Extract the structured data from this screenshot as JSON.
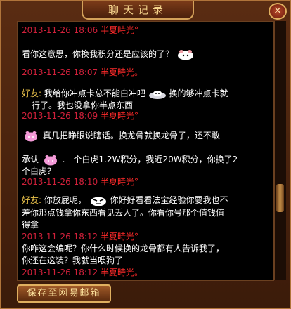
{
  "window": {
    "title": "聊天记录",
    "close_label": "×"
  },
  "messages": [
    {
      "timestamp": "2013-11-26 18:06",
      "sender": "半夏時光°"
    },
    {
      "text": "看你这意思，你换我积分还是应该的了？",
      "emoticon": "smile-bun-icon"
    },
    {
      "timestamp": "2013-11-26 18:07",
      "sender": "半夏時光。"
    },
    {
      "friend_label": "好友:",
      "text_a": "我给你冲点卡总不能白冲吧",
      "text_b": "换的够冲点卡就",
      "text_c": "行了。我也没拿你半点东西",
      "emoticon": "ufo-bun-icon"
    },
    {
      "timestamp": "2013-11-26 18:09",
      "sender": "半夏時光°"
    },
    {
      "text_a": "真几把睁眼说瞎话。换龙骨就换龙骨了，还不敢",
      "text_b": "承认",
      "text_c": ".一个白虎1.2W积分，我近20W积分，你换了2",
      "text_d": "个白虎？",
      "emoticon": "pink-bun-icon"
    },
    {
      "timestamp": "2013-11-26 18:10",
      "sender": "半夏時光°"
    },
    {
      "friend_label": "好友:",
      "text_a": "你放屁呢，",
      "text_b": "你好好看看法宝经验你要我也不",
      "text_c": "差你那点钱拿你东西看见丢人了。你看你号那个值钱值",
      "text_d": "得拿",
      "emoticon": "angry-bun-icon"
    },
    {
      "timestamp": "2013-11-26 18:12",
      "sender": "半夏時光°"
    },
    {
      "text_a": "你咋这会编呢？你什么时候换的龙骨都有人告诉我了，",
      "text_b": "你还在这装？我就当喂狗了"
    },
    {
      "timestamp": "2013-11-26 18:12",
      "sender": "半夏時光。"
    }
  ],
  "footer": {
    "save_label": "保存至网易邮箱"
  },
  "colors": {
    "timestamp": "#d0203a",
    "sender": "#ff2a2a",
    "message": "#ffffff",
    "friend": "#e8c04a"
  }
}
